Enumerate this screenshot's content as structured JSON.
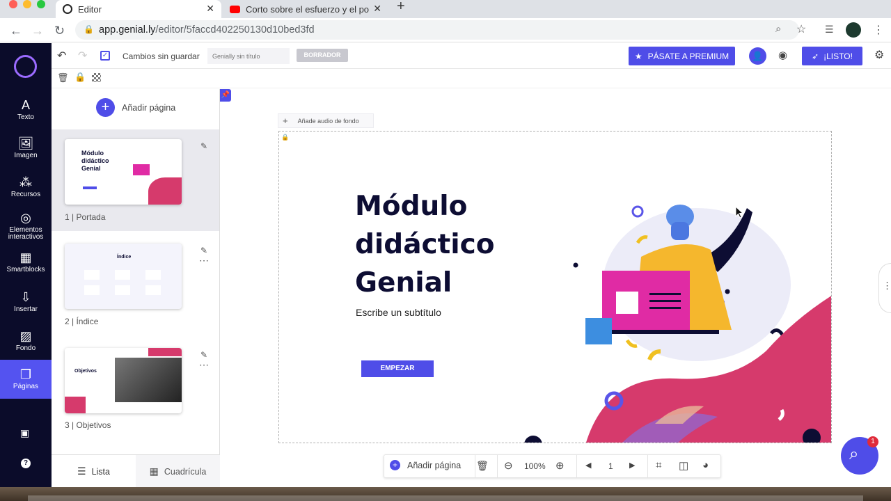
{
  "browser": {
    "tabs": [
      {
        "title": "Editor",
        "active": true
      },
      {
        "title": "Corto sobre el esfuerzo y el po",
        "active": false
      }
    ],
    "url_host": "app.genial.ly",
    "url_path": "/editor/5faccd402250130d10bed3fd"
  },
  "sidebar": {
    "items": [
      {
        "label": "Texto",
        "icon": "text-icon"
      },
      {
        "label": "Imagen",
        "icon": "image-icon"
      },
      {
        "label": "Recursos",
        "icon": "resources-icon"
      },
      {
        "label": "Elementos interactivos",
        "icon": "interactive-icon"
      },
      {
        "label": "Smartblocks",
        "icon": "smartblocks-icon"
      },
      {
        "label": "Insertar",
        "icon": "insert-icon"
      },
      {
        "label": "Fondo",
        "icon": "background-icon"
      },
      {
        "label": "Páginas",
        "icon": "pages-icon"
      }
    ]
  },
  "toolbar": {
    "save_status": "Cambios sin guardar",
    "title_placeholder": "Genially sin título",
    "draft_label": "BORRADOR",
    "premium_label": "PÁSATE A PREMIUM",
    "ready_label": "¡LISTO!"
  },
  "pages_panel": {
    "add_page_label": "Añadir página",
    "pages": [
      {
        "number": "1",
        "name": "Portada",
        "label": "1 | Portada"
      },
      {
        "number": "2",
        "name": "Índice",
        "label": "2 | Índice"
      },
      {
        "number": "3",
        "name": "Objetivos",
        "label": "3 | Objetivos"
      }
    ],
    "thumb1": {
      "title": "Módulo didáctico Genial"
    },
    "thumb2": {
      "title": "Índice"
    },
    "thumb3": {
      "title": "Objetivos"
    },
    "view_list": "Lista",
    "view_grid": "Cuadrícula"
  },
  "canvas": {
    "audio_label": "Añade audio de fondo",
    "title_line1": "Módulo",
    "title_line2": "didáctico",
    "title_line3": "Genial",
    "subtitle": "Escribe un subtítulo",
    "start_button": "EMPEZAR"
  },
  "bottom_bar": {
    "add_page_label": "Añadir página",
    "zoom": "100%",
    "page_number": "1"
  },
  "chat": {
    "badge": "1"
  },
  "colors": {
    "accent": "#4f4de8",
    "sidebar": "#0b0c2a",
    "title": "#0d0d33",
    "pink": "#d63a6c"
  }
}
